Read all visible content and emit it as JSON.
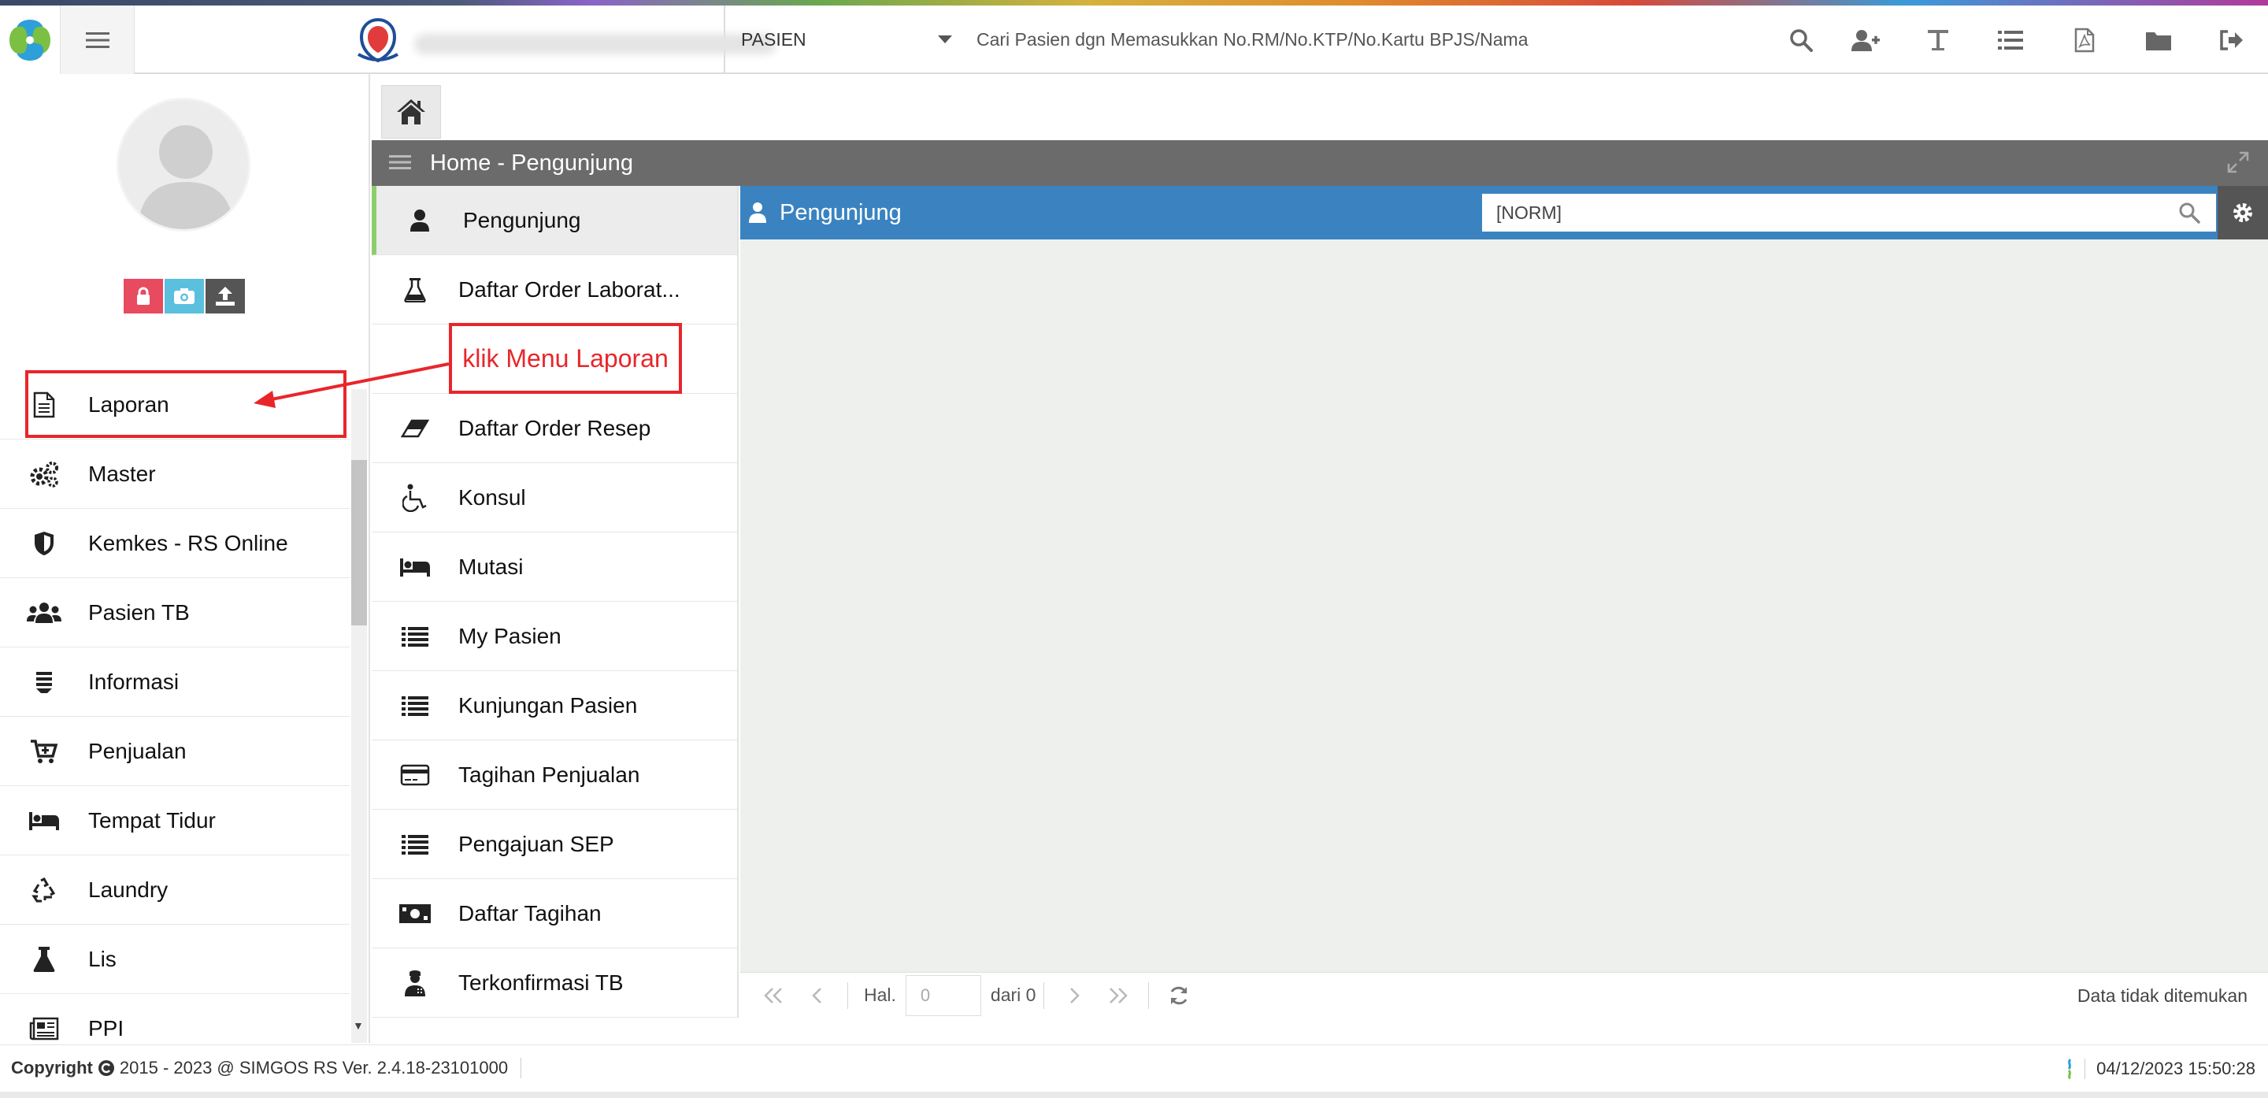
{
  "topbar": {
    "search_type": "PASIEN",
    "search_placeholder": "Cari Pasien dgn Memasukkan No.RM/No.KTP/No.Kartu BPJS/Nama",
    "icons": [
      "search-icon",
      "add-user-icon",
      "text-icon",
      "list-icon",
      "pdf-icon",
      "folder-icon",
      "sign-out-icon"
    ]
  },
  "sidebar": {
    "items": [
      {
        "label": "Laporan",
        "icon": "document-icon"
      },
      {
        "label": "Master",
        "icon": "gears-icon"
      },
      {
        "label": "Kemkes - RS Online",
        "icon": "shield-icon"
      },
      {
        "label": "Pasien TB",
        "icon": "users-icon"
      },
      {
        "label": "Informasi",
        "icon": "info-list-icon"
      },
      {
        "label": "Penjualan",
        "icon": "cart-icon"
      },
      {
        "label": "Tempat Tidur",
        "icon": "bed-icon"
      },
      {
        "label": "Laundry",
        "icon": "recycle-icon"
      },
      {
        "label": "Lis",
        "icon": "flask-icon"
      },
      {
        "label": "PPI",
        "icon": "newspaper-icon"
      }
    ]
  },
  "panel": {
    "title": "Home - Pengunjung"
  },
  "submenu": {
    "items": [
      {
        "label": "Pengunjung",
        "icon": "user-icon"
      },
      {
        "label": "Daftar Order Laborat...",
        "icon": "flask-icon"
      },
      {
        "label": "",
        "icon": ""
      },
      {
        "label": "Daftar Order Resep",
        "icon": "eraser-icon"
      },
      {
        "label": "Konsul",
        "icon": "wheelchair-icon"
      },
      {
        "label": "Mutasi",
        "icon": "bed-icon"
      },
      {
        "label": "My Pasien",
        "icon": "list-icon"
      },
      {
        "label": "Kunjungan Pasien",
        "icon": "list-icon"
      },
      {
        "label": "Tagihan Penjualan",
        "icon": "credit-card-icon"
      },
      {
        "label": "Pengajuan SEP",
        "icon": "list-icon"
      },
      {
        "label": "Daftar Tagihan",
        "icon": "money-icon"
      },
      {
        "label": "Terkonfirmasi TB",
        "icon": "user-medical-icon"
      }
    ]
  },
  "main": {
    "header_title": "Pengunjung",
    "norm_value": "[NORM]"
  },
  "pager": {
    "page_label": "Hal.",
    "page_value": "0",
    "of_label": "dari 0",
    "status": "Data tidak ditemukan"
  },
  "footer": {
    "copyright_bold": "Copyright",
    "copyright_rest": "2015 - 2023 @ SIMGOS RS Ver. 2.4.18-23101000",
    "datetime": "04/12/2023 15:50:28"
  },
  "annotation": {
    "callout_text": "klik Menu Laporan",
    "color": "#e8262a"
  },
  "colors": {
    "header_blue": "#3a83c0",
    "panel_gray": "#6b6b6b",
    "active_green": "#8ccf6a",
    "lock_red": "#e84a5f",
    "camera_blue": "#5bc0de",
    "upload_gray": "#555555"
  }
}
